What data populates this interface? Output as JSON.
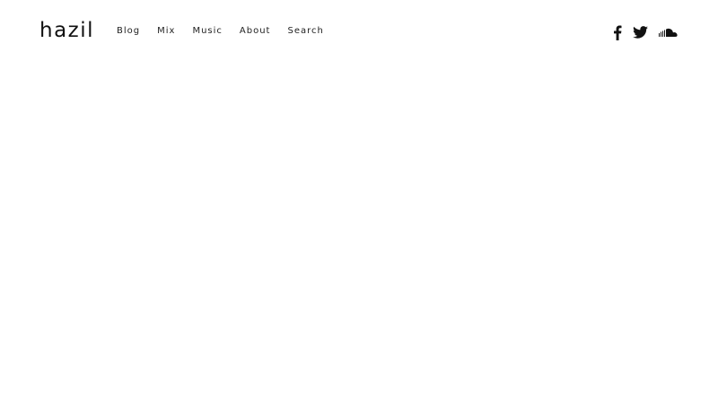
{
  "header": {
    "brand": "hazil",
    "nav": [
      {
        "label": "Blog"
      },
      {
        "label": "Mix"
      },
      {
        "label": "Music"
      },
      {
        "label": "About"
      },
      {
        "label": "Search"
      }
    ],
    "social": [
      {
        "icon": "facebook-icon"
      },
      {
        "icon": "twitter-icon"
      },
      {
        "icon": "soundcloud-icon"
      }
    ]
  },
  "colors": {
    "background": "#ffffff",
    "text": "#111111"
  }
}
